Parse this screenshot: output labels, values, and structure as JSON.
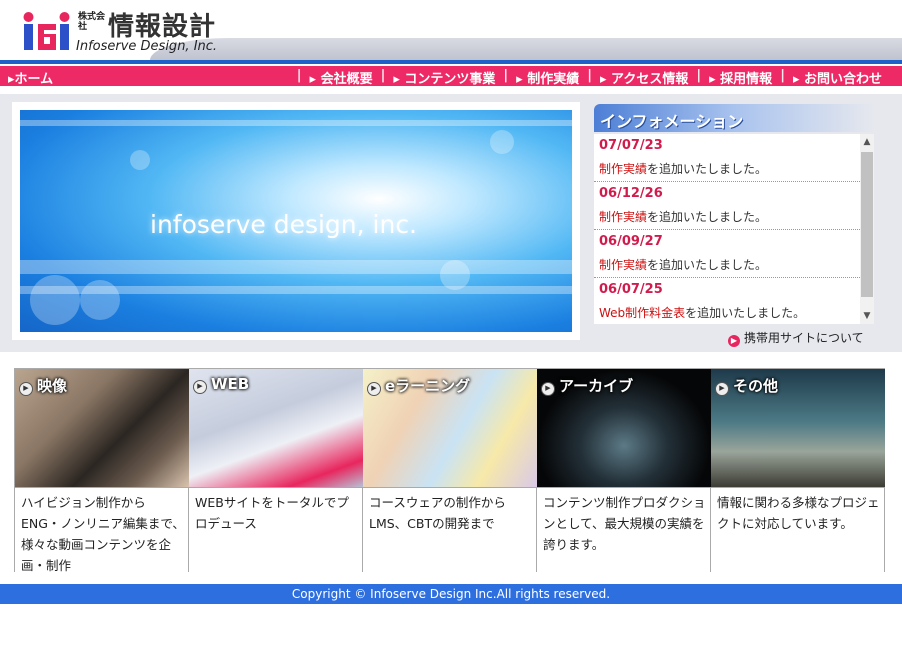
{
  "header": {
    "logo_corp": "株式会社",
    "logo_name": "情報設計",
    "logo_en": "Infoserve Design, Inc."
  },
  "nav": {
    "home": "▸ホーム",
    "items": [
      {
        "label": "▸ 会社概要"
      },
      {
        "label": "▸ コンテンツ事業"
      },
      {
        "label": "▸ 制作実績"
      },
      {
        "label": "▸ アクセス情報"
      },
      {
        "label": "▸ 採用情報"
      },
      {
        "label": "▸ お問い合わせ"
      }
    ]
  },
  "banner": {
    "text": "infoserve design, inc."
  },
  "info": {
    "title": "インフォメーション",
    "items": [
      {
        "date": "07/07/23",
        "link": "制作実績",
        "rest": "を追加いたしました。"
      },
      {
        "date": "06/12/26",
        "link": "制作実績",
        "rest": "を追加いたしました。"
      },
      {
        "date": "06/09/27",
        "link": "制作実績",
        "rest": "を追加いたしました。"
      },
      {
        "date": "06/07/25",
        "link": "Web制作料金表",
        "rest": "を追加いたしました。"
      }
    ],
    "mobile_link": "携帯用サイトについて"
  },
  "services": [
    {
      "label": "映像",
      "desc": "ハイビジョン制作からENG・ノンリニア編集まで、様々な動画コンテンツを企画・制作"
    },
    {
      "label": "WEB",
      "desc": "WEBサイトをトータルでプロデュース"
    },
    {
      "label": "eラーニング",
      "desc": "コースウェアの制作からLMS、CBTの開発まで"
    },
    {
      "label": "アーカイブ",
      "desc": "コンテンツ制作プロダクションとして、最大規模の実績を誇ります。"
    },
    {
      "label": "その他",
      "desc": "情報に関わる多様なプロジェクトに対応しています。"
    }
  ],
  "footer": {
    "copyright": "Copyright © Infoserve Design Inc.All rights reserved."
  },
  "colors": {
    "nav": "#ee2a66",
    "footer": "#2e6fe0",
    "accent_blue": "#1f5fc8",
    "date": "#d01c4c"
  }
}
